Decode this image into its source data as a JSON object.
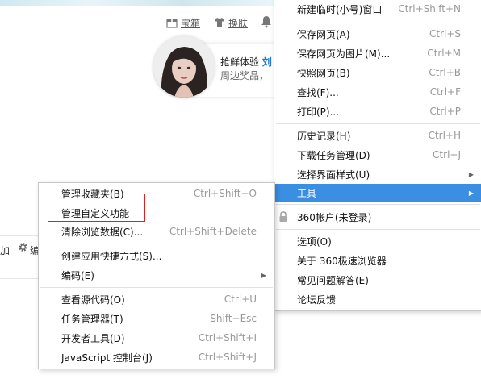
{
  "toolbar": {
    "treasure_label": "宝箱",
    "skin_label": "换肤"
  },
  "promo": {
    "line1_prefix": "抢鲜体验",
    "line1_highlight": "刘",
    "line2": "周边奖品，"
  },
  "background": {
    "left_text": "加",
    "edit_text": "编"
  },
  "main_menu": {
    "items": [
      {
        "label": "新建临时(小号)窗口",
        "shortcut": "Ctrl+Shift+N"
      },
      {
        "label": "保存网页(A)",
        "shortcut": "Ctrl+S"
      },
      {
        "label": "保存网页为图片(M)...",
        "shortcut": "Ctrl+M"
      },
      {
        "label": "快照网页(B)",
        "shortcut": "Ctrl+B"
      },
      {
        "label": "查找(F)...",
        "shortcut": "Ctrl+F"
      },
      {
        "label": "打印(P)...",
        "shortcut": "Ctrl+P"
      },
      {
        "label": "历史记录(H)",
        "shortcut": "Ctrl+H"
      },
      {
        "label": "下载任务管理(D)",
        "shortcut": "Ctrl+J"
      },
      {
        "label": "选择界面样式(U)",
        "shortcut": ""
      },
      {
        "label": "工具",
        "shortcut": ""
      },
      {
        "label": "360帐户(未登录)",
        "shortcut": ""
      },
      {
        "label": "选项(O)",
        "shortcut": ""
      },
      {
        "label": "关于 360极速浏览器",
        "shortcut": ""
      },
      {
        "label": "常见问题解答(E)",
        "shortcut": ""
      },
      {
        "label": "论坛反馈",
        "shortcut": ""
      }
    ]
  },
  "sub_menu": {
    "items": [
      {
        "label": "管理收藏夹(B)",
        "shortcut": "Ctrl+Shift+O"
      },
      {
        "label": "管理自定义功能",
        "shortcut": ""
      },
      {
        "label": "清除浏览数据(C)...",
        "shortcut": "Ctrl+Shift+Delete"
      },
      {
        "label": "创建应用快捷方式(S)...",
        "shortcut": ""
      },
      {
        "label": "编码(E)",
        "shortcut": ""
      },
      {
        "label": "查看源代码(O)",
        "shortcut": "Ctrl+U"
      },
      {
        "label": "任务管理器(T)",
        "shortcut": "Shift+Esc"
      },
      {
        "label": "开发者工具(D)",
        "shortcut": "Ctrl+Shift+I"
      },
      {
        "label": "JavaScript 控制台(J)",
        "shortcut": "Ctrl+Shift+J"
      }
    ]
  },
  "colors": {
    "selected_bg": "#3b8fe3",
    "highlight_border": "#e0201d",
    "promo_highlight": "#1e78d2"
  }
}
